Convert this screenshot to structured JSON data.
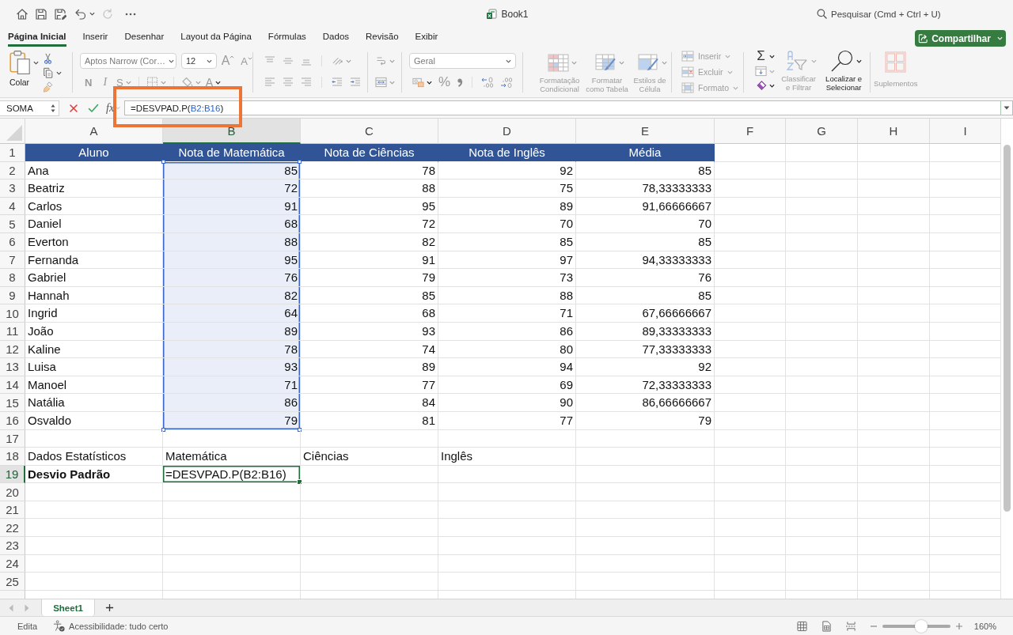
{
  "title_bar": {
    "quick_access": [
      {
        "kind": "home",
        "disabled": false
      },
      {
        "kind": "save",
        "disabled": false
      },
      {
        "kind": "save_as",
        "disabled": false
      },
      {
        "kind": "undo",
        "disabled": false
      },
      {
        "kind": "redo",
        "disabled": true
      },
      {
        "kind": "more",
        "disabled": false
      }
    ],
    "title": "Book1",
    "search": {
      "placeholder": "Pesquisar (Cmd + Ctrl + U)"
    }
  },
  "ribbon_tabs": [
    {
      "label": "Página Inicial",
      "selected": true
    },
    {
      "label": "Inserir",
      "selected": false
    },
    {
      "label": "Desenhar",
      "selected": false
    },
    {
      "label": "Layout da Página",
      "selected": false
    },
    {
      "label": "Fórmulas",
      "selected": false
    },
    {
      "label": "Dados",
      "selected": false
    },
    {
      "label": "Revisão",
      "selected": false
    },
    {
      "label": "Exibir",
      "selected": false
    }
  ],
  "share_button": {
    "label": "Compartilhar"
  },
  "ribbon": {
    "paste": {
      "label": "Colar",
      "disabled": false
    },
    "font_name": "Aptos Narrow (Cor…",
    "font_size": "12",
    "font_grow": "A",
    "font_shrink": "A",
    "bold": "N",
    "italic": "I",
    "underline": "S",
    "font_color": "A",
    "number_format": "Geral",
    "percent": "%",
    "style_buttons": [
      {
        "kind": "conditional",
        "label": "Formatação Condicional",
        "disabled": true
      },
      {
        "kind": "table",
        "label": "Formatar como Tabela",
        "disabled": true
      },
      {
        "kind": "cell_styles",
        "label": "Estilos de Célula",
        "disabled": true
      }
    ],
    "cell_buttons": [
      {
        "kind": "insert",
        "label": "Inserir",
        "disabled": true
      },
      {
        "kind": "delete",
        "label": "Excluir",
        "disabled": true
      },
      {
        "kind": "format",
        "label": "Formato",
        "disabled": true
      }
    ],
    "autosum": "Σ",
    "sort_filter": {
      "label": "Classificar e Filtrar",
      "disabled": true
    },
    "find_select": {
      "label": "Localizar e Selecionar",
      "disabled": false
    },
    "add_ins": {
      "label": "Suplementos",
      "disabled": true
    }
  },
  "formula_bar": {
    "name_box": "SOMA",
    "function_label": "fx",
    "formula": [
      {
        "text": "=DESVPAD.P(",
        "kind": "text"
      },
      {
        "text": "B2:B16",
        "kind": "reference"
      },
      {
        "text": ")",
        "kind": "text"
      }
    ],
    "highlighted": true
  },
  "sheet": {
    "columns": [
      {
        "label": "A",
        "selected": false
      },
      {
        "label": "B",
        "selected": true
      },
      {
        "label": "C",
        "selected": false
      },
      {
        "label": "D",
        "selected": false
      },
      {
        "label": "E",
        "selected": false
      },
      {
        "label": "F",
        "selected": false
      },
      {
        "label": "G",
        "selected": false
      },
      {
        "label": "H",
        "selected": false
      },
      {
        "label": "I",
        "selected": false
      }
    ],
    "rows": [
      {
        "number": "1",
        "kind": "header",
        "selected": false,
        "in_reference": false,
        "cells": [
          "Aluno",
          "Nota de Matemática",
          "Nota de Ciências",
          "Nota de Inglês",
          "Média"
        ]
      },
      {
        "number": "2",
        "kind": "record",
        "selected": false,
        "in_reference": true,
        "cells": [
          "Ana",
          "85",
          "78",
          "92",
          "85"
        ]
      },
      {
        "number": "3",
        "kind": "record",
        "selected": false,
        "in_reference": true,
        "cells": [
          "Beatriz",
          "72",
          "88",
          "75",
          "78,33333333"
        ]
      },
      {
        "number": "4",
        "kind": "record",
        "selected": false,
        "in_reference": true,
        "cells": [
          "Carlos",
          "91",
          "95",
          "89",
          "91,66666667"
        ]
      },
      {
        "number": "5",
        "kind": "record",
        "selected": false,
        "in_reference": true,
        "cells": [
          "Daniel",
          "68",
          "72",
          "70",
          "70"
        ]
      },
      {
        "number": "6",
        "kind": "record",
        "selected": false,
        "in_reference": true,
        "cells": [
          "Everton",
          "88",
          "82",
          "85",
          "85"
        ]
      },
      {
        "number": "7",
        "kind": "record",
        "selected": false,
        "in_reference": true,
        "cells": [
          "Fernanda",
          "95",
          "91",
          "97",
          "94,33333333"
        ]
      },
      {
        "number": "8",
        "kind": "record",
        "selected": false,
        "in_reference": true,
        "cells": [
          "Gabriel",
          "76",
          "79",
          "73",
          "76"
        ]
      },
      {
        "number": "9",
        "kind": "record",
        "selected": false,
        "in_reference": true,
        "cells": [
          "Hannah",
          "82",
          "85",
          "88",
          "85"
        ]
      },
      {
        "number": "10",
        "kind": "record",
        "selected": false,
        "in_reference": true,
        "cells": [
          "Ingrid",
          "64",
          "68",
          "71",
          "67,66666667"
        ]
      },
      {
        "number": "11",
        "kind": "record",
        "selected": false,
        "in_reference": true,
        "cells": [
          "João",
          "89",
          "93",
          "86",
          "89,33333333"
        ]
      },
      {
        "number": "12",
        "kind": "record",
        "selected": false,
        "in_reference": true,
        "cells": [
          "Kaline",
          "78",
          "74",
          "80",
          "77,33333333"
        ]
      },
      {
        "number": "13",
        "kind": "record",
        "selected": false,
        "in_reference": true,
        "cells": [
          "Luisa",
          "93",
          "89",
          "94",
          "92"
        ]
      },
      {
        "number": "14",
        "kind": "record",
        "selected": false,
        "in_reference": true,
        "cells": [
          "Manoel",
          "71",
          "77",
          "69",
          "72,33333333"
        ]
      },
      {
        "number": "15",
        "kind": "record",
        "selected": false,
        "in_reference": true,
        "cells": [
          "Natália",
          "86",
          "84",
          "90",
          "86,66666667"
        ]
      },
      {
        "number": "16",
        "kind": "record",
        "selected": false,
        "in_reference": true,
        "cells": [
          "Osvaldo",
          "79",
          "81",
          "77",
          "79"
        ]
      },
      {
        "number": "17",
        "kind": "empty",
        "selected": false,
        "in_reference": false
      },
      {
        "number": "18",
        "kind": "labels",
        "selected": false,
        "in_reference": false,
        "cells": [
          "Dados Estatísticos",
          "Matemática",
          "Ciências",
          "Inglês"
        ]
      },
      {
        "number": "19",
        "kind": "stat",
        "selected": true,
        "in_reference": false,
        "cells": [
          "Desvio Padrão",
          "=DESVPAD.P(B2:B16)"
        ]
      },
      {
        "number": "20",
        "kind": "empty",
        "selected": false,
        "in_reference": false
      },
      {
        "number": "21",
        "kind": "empty",
        "selected": false,
        "in_reference": false
      },
      {
        "number": "22",
        "kind": "empty",
        "selected": false,
        "in_reference": false
      },
      {
        "number": "23",
        "kind": "empty",
        "selected": false,
        "in_reference": false
      },
      {
        "number": "24",
        "kind": "empty",
        "selected": false,
        "in_reference": false
      },
      {
        "number": "25",
        "kind": "empty",
        "selected": false,
        "in_reference": false
      }
    ]
  },
  "sheet_tabs": [
    {
      "label": "Sheet1",
      "selected": true
    }
  ],
  "status_bar": {
    "mode": "Edita",
    "accessibility": "Acessibilidade: tudo certo",
    "zoom": {
      "level": 0.57,
      "reading": "160%"
    }
  }
}
